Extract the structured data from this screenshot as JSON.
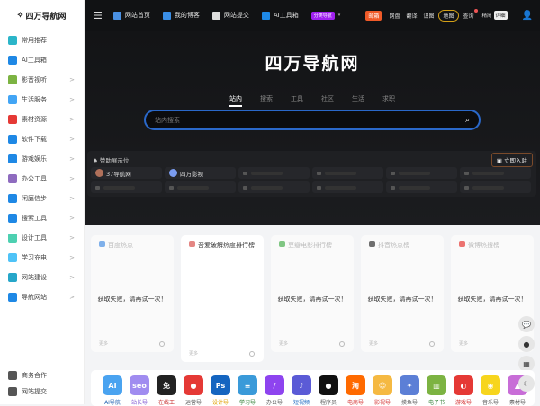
{
  "brand": {
    "name": "四万导航网"
  },
  "sidebar": {
    "items": [
      {
        "label": "常用推荐",
        "color": "#2bb5c9",
        "chev": false
      },
      {
        "label": "AI工具箱",
        "color": "#1e88e5",
        "chev": false
      },
      {
        "label": "影音视听",
        "color": "#7cb342",
        "chev": true
      },
      {
        "label": "生活服务",
        "color": "#42a5f5",
        "chev": true
      },
      {
        "label": "素材资源",
        "color": "#e53935",
        "chev": true
      },
      {
        "label": "软件下载",
        "color": "#1e88e5",
        "chev": true
      },
      {
        "label": "游戏娱乐",
        "color": "#1e88e5",
        "chev": true
      },
      {
        "label": "办公工具",
        "color": "#8e6bbf",
        "chev": true
      },
      {
        "label": "闲庭信步",
        "color": "#1e88e5",
        "chev": true
      },
      {
        "label": "搜索工具",
        "color": "#1e88e5",
        "chev": true
      },
      {
        "label": "设计工具",
        "color": "#4dd0b1",
        "chev": true
      },
      {
        "label": "学习充电",
        "color": "#4fc3f7",
        "chev": true
      },
      {
        "label": "网站建设",
        "color": "#26a6c9",
        "chev": true
      },
      {
        "label": "导航网站",
        "color": "#1e88e5",
        "chev": true
      }
    ],
    "bottom": [
      {
        "label": "商务合作"
      },
      {
        "label": "网站提交"
      }
    ],
    "chevron": ">"
  },
  "topbar": {
    "nav": [
      {
        "label": "网站首页",
        "color": "#4a90e2"
      },
      {
        "label": "我的博客",
        "color": "#3a8ee6"
      },
      {
        "label": "网站提交",
        "color": "#ddd"
      },
      {
        "label": "AI工具箱",
        "color": "#1e88e5"
      }
    ],
    "badge": "分类导航",
    "mail": "邮箱",
    "links": [
      "网盘",
      "翻译",
      "识图"
    ],
    "map": "地图",
    "query": "查询",
    "hot": "精简",
    "detail": "详细"
  },
  "hero": {
    "title": "四万导航网",
    "tabs": [
      "站内",
      "搜索",
      "工具",
      "社区",
      "生活",
      "求职"
    ],
    "search_placeholder": "站内搜索"
  },
  "sponsor": {
    "title": "赞助展示位",
    "join": "立即入驻",
    "sites": [
      {
        "label": "37导航网",
        "color": "#b0705a"
      },
      {
        "label": "四万影视",
        "color": "#7a9cf0"
      }
    ]
  },
  "cards": [
    {
      "title": "百度热点",
      "icon_color": "#4a90e2",
      "msg": "获取失败，请再试一次！",
      "more": "更多",
      "active": false
    },
    {
      "title": "吾爱破解热度排行榜",
      "icon_color": "#d9534f",
      "msg": "",
      "more": "更多",
      "active": true
    },
    {
      "title": "豆瓣电影排行榜",
      "icon_color": "#4caf50",
      "msg": "获取失败，请再试一次！",
      "more": "更多",
      "active": false
    },
    {
      "title": "抖音热点榜",
      "icon_color": "#333",
      "msg": "获取失败，请再试一次！",
      "more": "更多",
      "active": false
    },
    {
      "title": "微博热搜榜",
      "icon_color": "#e53935",
      "msg": "获取失败，请再试一次！",
      "more": "更多",
      "active": false
    }
  ],
  "dock": [
    {
      "label": "AI导航",
      "color": "#4aa3f0",
      "lc": "#1e5fb0",
      "g": "AI"
    },
    {
      "label": "站长导",
      "color": "#a08cf0",
      "lc": "#7b4fd0",
      "g": "seo"
    },
    {
      "label": "在线工",
      "color": "#222",
      "lc": "#c62828",
      "g": "免"
    },
    {
      "label": "运营导",
      "color": "#e53935",
      "lc": "#555",
      "g": "●"
    },
    {
      "label": "设计导",
      "color": "#1565c0",
      "lc": "#e0a000",
      "g": "Ps"
    },
    {
      "label": "学习导",
      "color": "#3a9ad9",
      "lc": "#2e7d32",
      "g": "≡"
    },
    {
      "label": "办公导",
      "color": "#8e44ef",
      "lc": "#555",
      "g": "/"
    },
    {
      "label": "短视频",
      "color": "#5b5bd6",
      "lc": "#1565c0",
      "g": "♪"
    },
    {
      "label": "程序员",
      "color": "#111",
      "lc": "#555",
      "g": "●"
    },
    {
      "label": "电商导",
      "color": "#ff6a00",
      "lc": "#d32f2f",
      "g": "淘"
    },
    {
      "label": "影视导",
      "color": "#f5b942",
      "lc": "#d32f2f",
      "g": "☺"
    },
    {
      "label": "摸鱼导",
      "color": "#5c7fd6",
      "lc": "#555",
      "g": "✦"
    },
    {
      "label": "电子书",
      "color": "#7cb342",
      "lc": "#2e7d32",
      "g": "▥"
    },
    {
      "label": "游戏导",
      "color": "#e53935",
      "lc": "#d32f2f",
      "g": "◐"
    },
    {
      "label": "音乐导",
      "color": "#f7d51d",
      "lc": "#555",
      "g": "◉"
    },
    {
      "label": "素材导",
      "color": "#c86dd7",
      "lc": "#555",
      "g": "▲"
    }
  ]
}
